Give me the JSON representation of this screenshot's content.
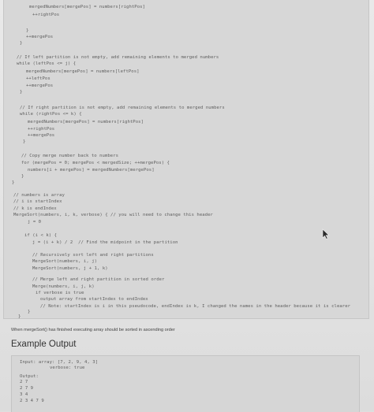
{
  "code": {
    "lines": [
      {
        "text": "mergedNumbers[mergePos] = numbers[rightPos]",
        "indent": 32
      },
      {
        "text": "++rightPos",
        "indent": 36
      },
      {
        "text": "}",
        "indent": 28
      },
      {
        "text": "++mergePos",
        "indent": 28
      },
      {
        "text": "}",
        "indent": 20
      },
      {
        "text": "// If left partition is not empty, add remaining elements to merged numbers",
        "indent": 16
      },
      {
        "text": "while (leftPos <= j) {",
        "indent": 16
      },
      {
        "text": "mergedNumbers[mergePos] = numbers[leftPos]",
        "indent": 28
      },
      {
        "text": "++leftPos",
        "indent": 28
      },
      {
        "text": "++mergePos",
        "indent": 28
      },
      {
        "text": "}",
        "indent": 20
      },
      {
        "text": "// If right partition is not empty, add remaining elements to merged numbers",
        "indent": 20
      },
      {
        "text": "while (rightPos <= k) {",
        "indent": 20
      },
      {
        "text": "mergedNumbers[mergePos] = numbers[rightPos]",
        "indent": 30
      },
      {
        "text": "++rightPos",
        "indent": 30
      },
      {
        "text": "++mergePos",
        "indent": 30
      },
      {
        "text": "}",
        "indent": 24
      },
      {
        "text": "// Copy merge number back to numbers",
        "indent": 22
      },
      {
        "text": "for (mergePos = 0; mergePos < mergedSize; ++mergePos) {",
        "indent": 22
      },
      {
        "text": "numbers[i + mergePos] = mergedNumbers[mergePos]",
        "indent": 30
      },
      {
        "text": "}",
        "indent": 22
      },
      {
        "text": "}",
        "indent": 10
      },
      {
        "text": "// numbers is array",
        "indent": 12
      },
      {
        "text": "// i is startIndex",
        "indent": 12
      },
      {
        "text": "// k is endIndex",
        "indent": 12
      },
      {
        "text": "MergeSort(numbers, i, k, verbose) { // you will need to change this header",
        "indent": 12
      },
      {
        "text": "j = 0",
        "indent": 30
      },
      {
        "text": "if (i < k) {",
        "indent": 26
      },
      {
        "text": "j = (i + k) / 2  // Find the midpoint in the partition",
        "indent": 36
      },
      {
        "text": "// Recursively sort left and right partitions",
        "indent": 36
      },
      {
        "text": "MergeSort(numbers, i, j)",
        "indent": 36
      },
      {
        "text": "MergeSort(numbers, j + 1, k)",
        "indent": 36
      },
      {
        "text": "// Merge left and right partition in sorted order",
        "indent": 36
      },
      {
        "text": "Merge(numbers, i, j, k)",
        "indent": 36
      },
      {
        "text": "if verbose is true",
        "indent": 40
      },
      {
        "text": "output array from startIndex to endIndex",
        "indent": 46
      },
      {
        "text": "// Note: startIndex is i in this pseudocode, endIndex is k, I changed the names in the header because it is clearer",
        "indent": 46
      },
      {
        "text": "}",
        "indent": 30
      },
      {
        "text": "}",
        "indent": 18
      }
    ]
  },
  "description": "When mergeSort() has finished executing array should be sorted in ascending order",
  "example_output": {
    "title": "Example Output",
    "lines": [
      {
        "text": "Input: array: [7, 2, 9, 4, 3]",
        "indent": 10
      },
      {
        "text": "verbose: true",
        "indent": 48
      },
      {
        "text": "Output:",
        "indent": 10
      },
      {
        "text": "2 7",
        "indent": 10
      },
      {
        "text": "2 7 9",
        "indent": 10
      },
      {
        "text": "3 4",
        "indent": 10
      },
      {
        "text": "2 3 4 7 9",
        "indent": 10
      }
    ]
  },
  "icons": {
    "cursor": "mouse-pointer-icon"
  }
}
